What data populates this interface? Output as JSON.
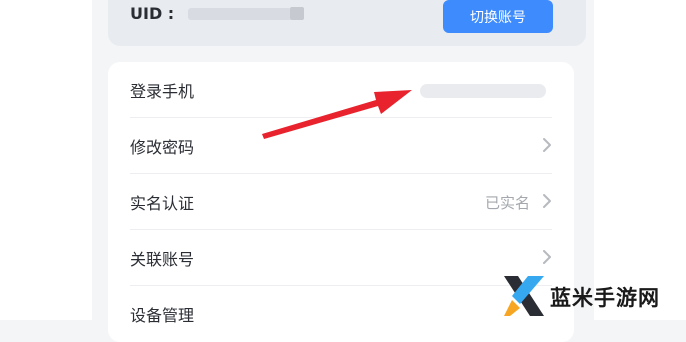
{
  "account": {
    "uid_label": "UID :",
    "switch_button": "切换账号"
  },
  "settings": {
    "items": [
      {
        "label": "登录手机",
        "value": ""
      },
      {
        "label": "修改密码",
        "value": ""
      },
      {
        "label": "实名认证",
        "value": "已实名"
      },
      {
        "label": "关联账号",
        "value": ""
      },
      {
        "label": "设备管理",
        "value": ""
      }
    ]
  },
  "watermark": {
    "text": "蓝米手游网"
  },
  "colors": {
    "accent": "#3d8bfd",
    "annotation_arrow": "#e8232d",
    "card_background": "#ffffff",
    "uid_card_background": "#e8ebf0"
  },
  "icons": {
    "row_chevron": "chevron-right-icon",
    "annotation": "arrow-annotation-icon",
    "watermark_logo": "lanmi-logo-icon"
  }
}
